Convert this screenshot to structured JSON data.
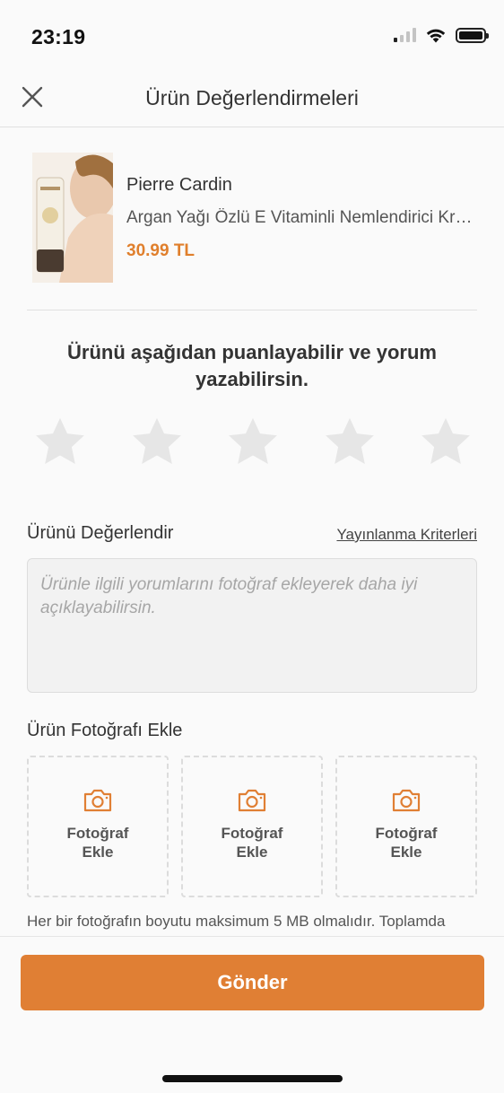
{
  "status_bar": {
    "time": "23:19",
    "icons": [
      "cellular-signal-icon",
      "wifi-icon",
      "battery-icon"
    ]
  },
  "header": {
    "title": "Ürün Değerlendirmeleri",
    "close_icon": "close-icon"
  },
  "product": {
    "brand": "Pierre Cardin",
    "name": "Argan Yağı Özlü E Vitaminli Nemlendirici Krem",
    "price": "30.99 TL"
  },
  "rating": {
    "prompt": "Ürünü aşağıdan puanlayabilir ve yorum yazabilirsin.",
    "max_stars": 5,
    "selected": 0
  },
  "review": {
    "title": "Ürünü Değerlendir",
    "criteria_link": "Yayınlanma Kriterleri",
    "placeholder": "Ürünle ilgili yorumlarını fotoğraf ekleyerek daha iyi açıklayabilirsin.",
    "value": ""
  },
  "photos": {
    "title": "Ürün Fotoğrafı Ekle",
    "slot_label": "Fotoğraf Ekle",
    "slots": [
      "Fotoğraf Ekle",
      "Fotoğraf Ekle",
      "Fotoğraf Ekle"
    ],
    "note": "Her bir fotoğrafın boyutu maksimum 5 MB olmalıdır. Toplamda"
  },
  "footer": {
    "submit_label": "Gönder"
  },
  "colors": {
    "accent": "#E07F34",
    "price": "#E07F2C",
    "star_inactive": "#E6E6E6",
    "background": "#FAFAFA"
  }
}
